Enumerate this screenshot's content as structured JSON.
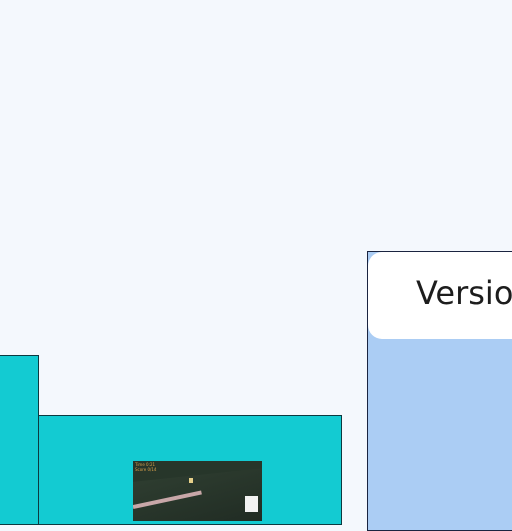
{
  "version_card": {
    "label": "Versio"
  },
  "game_thumbnail": {
    "hud_line1": "Time 0:21",
    "hud_line2": "Score 0/14"
  },
  "colors": {
    "background": "#f4f8fd",
    "teal": "#13cbd2",
    "blue_panel": "#abcdf4"
  }
}
